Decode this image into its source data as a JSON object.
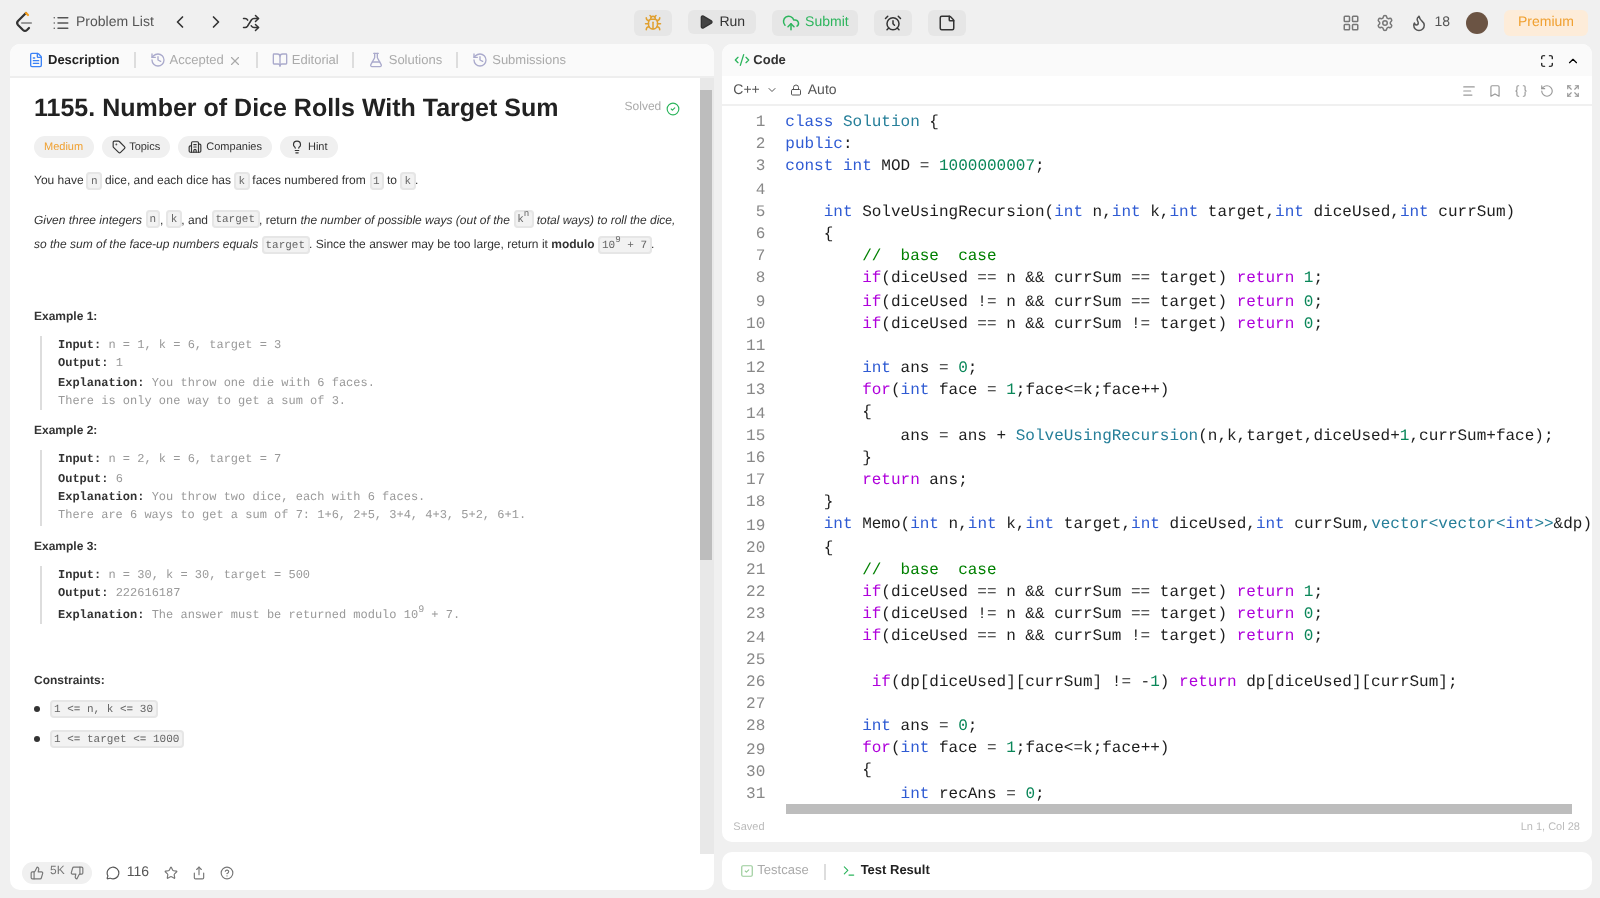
{
  "topbar": {
    "problem_list": "Problem List",
    "run": "Run",
    "submit": "Submit",
    "streak": "18",
    "premium": "Premium"
  },
  "tabs": [
    {
      "label": "Description",
      "selected": true,
      "closable": false
    },
    {
      "label": "Accepted",
      "selected": false,
      "closable": true
    },
    {
      "label": "Editorial",
      "selected": false,
      "closable": false
    },
    {
      "label": "Solutions",
      "selected": false,
      "closable": false
    },
    {
      "label": "Submissions",
      "selected": false,
      "closable": false
    }
  ],
  "problem": {
    "title": "1155. Number of Dice Rolls With Target Sum",
    "status": "Solved",
    "difficulty": "Medium",
    "tags": [
      "Topics",
      "Companies",
      "Hint"
    ],
    "paragraphs": [
      [
        {
          "kind": "text",
          "text": "You have "
        },
        {
          "kind": "code",
          "text": "n"
        },
        {
          "kind": "text",
          "text": " dice, and each dice has "
        },
        {
          "kind": "code",
          "text": "k"
        },
        {
          "kind": "text",
          "text": " faces numbered from "
        },
        {
          "kind": "code",
          "text": "1"
        },
        {
          "kind": "text",
          "text": " to "
        },
        {
          "kind": "code",
          "text": "k"
        },
        {
          "kind": "text",
          "text": "."
        }
      ],
      [
        {
          "kind": "italic",
          "text": "Given three integers "
        },
        {
          "kind": "code",
          "text": "n"
        },
        {
          "kind": "text",
          "text": ", "
        },
        {
          "kind": "code",
          "text": "k"
        },
        {
          "kind": "text",
          "text": ", and "
        },
        {
          "kind": "code",
          "text": "target"
        },
        {
          "kind": "text",
          "text": ", return "
        },
        {
          "kind": "italic",
          "text": "the number of possible ways (out of the "
        },
        {
          "kind": "code",
          "text": "k$^{n}$"
        },
        {
          "kind": "italic",
          "text": " total ways) to roll the dice, so the sum of the face-up numbers equals "
        },
        {
          "kind": "code",
          "text": "target"
        },
        {
          "kind": "text",
          "text": ". Since the answer may be too large, return it "
        },
        {
          "kind": "bold",
          "text": "modulo "
        },
        {
          "kind": "code",
          "text": "10$^{9}$ + 7"
        },
        {
          "kind": "text",
          "text": "."
        }
      ]
    ],
    "examples": [
      {
        "title": "Example 1:",
        "lines": [
          {
            "label": "Input:",
            "value": "n = 1, k = 6, target = 3"
          },
          {
            "label": "Output:",
            "value": "1"
          },
          {
            "label": "Explanation:",
            "value": "You throw one die with 6 faces."
          },
          {
            "value": "There is only one way to get a sum of 3."
          }
        ]
      },
      {
        "title": "Example 2:",
        "lines": [
          {
            "label": "Input:",
            "value": "n = 2, k = 6, target = 7"
          },
          {
            "label": "Output:",
            "value": "6"
          },
          {
            "label": "Explanation:",
            "value": "You throw two dice, each with 6 faces."
          },
          {
            "value": "There are 6 ways to get a sum of 7: 1+6, 2+5, 3+4, 4+3, 5+2, 6+1."
          }
        ]
      },
      {
        "title": "Example 3:",
        "lines": [
          {
            "label": "Input:",
            "value": "n = 30, k = 30, target = 500"
          },
          {
            "label": "Output:",
            "value": "222616187"
          },
          {
            "label": "Explanation:",
            "value": "The answer must be returned modulo 10$^{9}$ + 7."
          }
        ]
      }
    ],
    "constraints_title": "Constraints:",
    "constraints": [
      "1 <= n, k <= 30",
      "1 <= target <= 1000"
    ]
  },
  "footer": {
    "likes": "5K",
    "comments": "116"
  },
  "editor": {
    "title": "Code",
    "language": "C++",
    "mode": "Auto",
    "saved": "Saved",
    "cursor": "Ln 1, Col 28",
    "lines": [
      {
        "number": "1",
        "tokens": [
          {
            "kind": "kw",
            "text": "class "
          },
          {
            "kind": "fn",
            "text": "Solution"
          },
          {
            "kind": "tx",
            "text": " {"
          }
        ]
      },
      {
        "number": "2",
        "tokens": [
          {
            "kind": "kw",
            "text": "public"
          },
          {
            "kind": "tx",
            "text": ":"
          }
        ]
      },
      {
        "number": "3",
        "tokens": [
          {
            "kind": "kw",
            "text": "const int"
          },
          {
            "kind": "tx",
            "text": " MOD = "
          },
          {
            "kind": "num",
            "text": "1000000007"
          },
          {
            "kind": "tx",
            "text": ";"
          }
        ]
      },
      {
        "number": "4"
      },
      {
        "number": "5",
        "tokens": [
          {
            "kind": "kw",
            "text": "    int"
          },
          {
            "kind": "tx",
            "text": " SolveUsingRecursion("
          },
          {
            "kind": "kw",
            "text": "int"
          },
          {
            "kind": "tx",
            "text": " n,"
          },
          {
            "kind": "kw",
            "text": "int"
          },
          {
            "kind": "tx",
            "text": " k,"
          },
          {
            "kind": "kw",
            "text": "int"
          },
          {
            "kind": "tx",
            "text": " target,"
          },
          {
            "kind": "kw",
            "text": "int"
          },
          {
            "kind": "tx",
            "text": " diceUsed,"
          },
          {
            "kind": "kw",
            "text": "int"
          },
          {
            "kind": "tx",
            "text": " currSum)"
          }
        ]
      },
      {
        "number": "6",
        "tokens": [
          {
            "kind": "tx",
            "text": "    {"
          }
        ]
      },
      {
        "number": "7",
        "tokens": [
          {
            "kind": "cm",
            "text": "        //  base  case"
          }
        ]
      },
      {
        "number": "8",
        "tokens": [
          {
            "kind": "ctrl",
            "text": "        if"
          },
          {
            "kind": "tx",
            "text": "(diceUsed == n && currSum == target) "
          },
          {
            "kind": "ctrl",
            "text": "return"
          },
          {
            "kind": "num",
            "text": " 1"
          },
          {
            "kind": "tx",
            "text": ";"
          }
        ]
      },
      {
        "number": "9",
        "tokens": [
          {
            "kind": "ctrl",
            "text": "        if"
          },
          {
            "kind": "tx",
            "text": "(diceUsed != n && currSum == target) "
          },
          {
            "kind": "ctrl",
            "text": "return"
          },
          {
            "kind": "num",
            "text": " 0"
          },
          {
            "kind": "tx",
            "text": ";"
          }
        ]
      },
      {
        "number": "10",
        "tokens": [
          {
            "kind": "ctrl",
            "text": "        if"
          },
          {
            "kind": "tx",
            "text": "(diceUsed == n && currSum != target) "
          },
          {
            "kind": "ctrl",
            "text": "return"
          },
          {
            "kind": "num",
            "text": " 0"
          },
          {
            "kind": "tx",
            "text": ";"
          }
        ]
      },
      {
        "number": "11"
      },
      {
        "number": "12",
        "tokens": [
          {
            "kind": "kw",
            "text": "        int"
          },
          {
            "kind": "tx",
            "text": " ans = "
          },
          {
            "kind": "num",
            "text": "0"
          },
          {
            "kind": "tx",
            "text": ";"
          }
        ]
      },
      {
        "number": "13",
        "tokens": [
          {
            "kind": "ctrl",
            "text": "        for"
          },
          {
            "kind": "tx",
            "text": "("
          },
          {
            "kind": "kw",
            "text": "int"
          },
          {
            "kind": "tx",
            "text": " face = "
          },
          {
            "kind": "num",
            "text": "1"
          },
          {
            "kind": "tx",
            "text": ";face<=k;face++)"
          }
        ]
      },
      {
        "number": "14",
        "tokens": [
          {
            "kind": "tx",
            "text": "        {"
          }
        ]
      },
      {
        "number": "15",
        "tokens": [
          {
            "kind": "tx",
            "text": "            ans = ans + "
          },
          {
            "kind": "fn",
            "text": "SolveUsingRecursion"
          },
          {
            "kind": "tx",
            "text": "(n,k,target,diceUsed+"
          },
          {
            "kind": "num",
            "text": "1"
          },
          {
            "kind": "tx",
            "text": ",currSum+face);"
          }
        ]
      },
      {
        "number": "16",
        "tokens": [
          {
            "kind": "tx",
            "text": "        }"
          }
        ]
      },
      {
        "number": "17",
        "tokens": [
          {
            "kind": "ctrl",
            "text": "        return"
          },
          {
            "kind": "tx",
            "text": " ans;"
          }
        ]
      },
      {
        "number": "18",
        "tokens": [
          {
            "kind": "tx",
            "text": "    }"
          }
        ]
      },
      {
        "number": "19",
        "tokens": [
          {
            "kind": "kw",
            "text": "    int"
          },
          {
            "kind": "tx",
            "text": " Memo("
          },
          {
            "kind": "kw",
            "text": "int"
          },
          {
            "kind": "tx",
            "text": " n,"
          },
          {
            "kind": "kw",
            "text": "int"
          },
          {
            "kind": "tx",
            "text": " k,"
          },
          {
            "kind": "kw",
            "text": "int"
          },
          {
            "kind": "tx",
            "text": " target,"
          },
          {
            "kind": "kw",
            "text": "int"
          },
          {
            "kind": "tx",
            "text": " diceUsed,"
          },
          {
            "kind": "kw",
            "text": "int"
          },
          {
            "kind": "tx",
            "text": " currSum,"
          },
          {
            "kind": "fn",
            "text": "vector<vector<"
          },
          {
            "kind": "kw",
            "text": "int"
          },
          {
            "kind": "fn",
            "text": ">>"
          },
          {
            "kind": "tx",
            "text": "&dp)"
          }
        ]
      },
      {
        "number": "20",
        "tokens": [
          {
            "kind": "tx",
            "text": "    {"
          }
        ]
      },
      {
        "number": "21",
        "tokens": [
          {
            "kind": "cm",
            "text": "        //  base  case"
          }
        ]
      },
      {
        "number": "22",
        "tokens": [
          {
            "kind": "ctrl",
            "text": "        if"
          },
          {
            "kind": "tx",
            "text": "(diceUsed == n && currSum == target) "
          },
          {
            "kind": "ctrl",
            "text": "return"
          },
          {
            "kind": "num",
            "text": " 1"
          },
          {
            "kind": "tx",
            "text": ";"
          }
        ]
      },
      {
        "number": "23",
        "tokens": [
          {
            "kind": "ctrl",
            "text": "        if"
          },
          {
            "kind": "tx",
            "text": "(diceUsed != n && currSum == target) "
          },
          {
            "kind": "ctrl",
            "text": "return"
          },
          {
            "kind": "num",
            "text": " 0"
          },
          {
            "kind": "tx",
            "text": ";"
          }
        ]
      },
      {
        "number": "24",
        "tokens": [
          {
            "kind": "ctrl",
            "text": "        if"
          },
          {
            "kind": "tx",
            "text": "(diceUsed == n && currSum != target) "
          },
          {
            "kind": "ctrl",
            "text": "return"
          },
          {
            "kind": "num",
            "text": " 0"
          },
          {
            "kind": "tx",
            "text": ";"
          }
        ]
      },
      {
        "number": "25"
      },
      {
        "number": "26",
        "tokens": [
          {
            "kind": "ctrl",
            "text": "         if"
          },
          {
            "kind": "tx",
            "text": "(dp[diceUsed][currSum] != -"
          },
          {
            "kind": "num",
            "text": "1"
          },
          {
            "kind": "tx",
            "text": ") "
          },
          {
            "kind": "ctrl",
            "text": "return"
          },
          {
            "kind": "tx",
            "text": " dp[diceUsed][currSum];"
          }
        ]
      },
      {
        "number": "27"
      },
      {
        "number": "28",
        "tokens": [
          {
            "kind": "kw",
            "text": "        int"
          },
          {
            "kind": "tx",
            "text": " ans = "
          },
          {
            "kind": "num",
            "text": "0"
          },
          {
            "kind": "tx",
            "text": ";"
          }
        ]
      },
      {
        "number": "29",
        "tokens": [
          {
            "kind": "ctrl",
            "text": "        for"
          },
          {
            "kind": "tx",
            "text": "("
          },
          {
            "kind": "kw",
            "text": "int"
          },
          {
            "kind": "tx",
            "text": " face = "
          },
          {
            "kind": "num",
            "text": "1"
          },
          {
            "kind": "tx",
            "text": ";face<=k;face++)"
          }
        ]
      },
      {
        "number": "30",
        "tokens": [
          {
            "kind": "tx",
            "text": "        {"
          }
        ]
      },
      {
        "number": "31",
        "tokens": [
          {
            "kind": "kw",
            "text": "            int"
          },
          {
            "kind": "tx",
            "text": " recAns = "
          },
          {
            "kind": "num",
            "text": "0"
          },
          {
            "kind": "tx",
            "text": ";"
          }
        ]
      }
    ]
  },
  "bottom_tabs": [
    {
      "label": "Testcase",
      "selected": false
    },
    {
      "label": "Test Result",
      "selected": true
    }
  ]
}
